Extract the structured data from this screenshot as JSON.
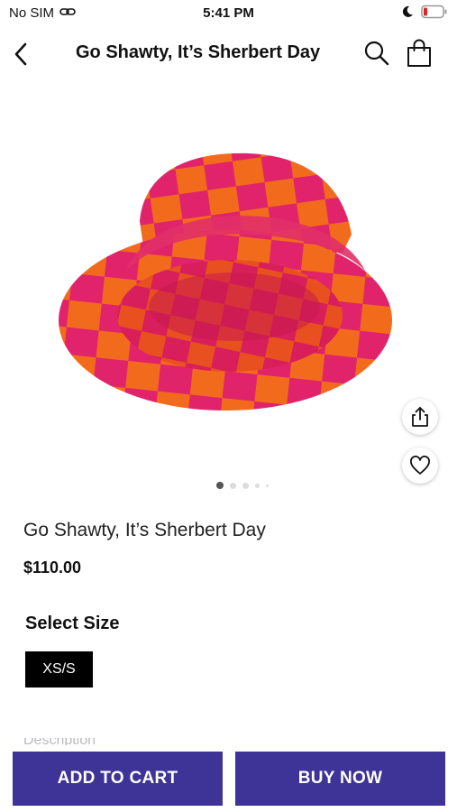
{
  "status": {
    "carrier": "No SIM",
    "time": "5:41 PM"
  },
  "header": {
    "title": "Go Shawty, It’s Sherbert Day",
    "icons": [
      "back-arrow-icon",
      "search-icon",
      "shopping-bag-icon"
    ]
  },
  "gallery": {
    "image_alt": "Crochet checkered bucket hat in orange and pink",
    "page_count": 5,
    "current_page": 1,
    "colors": {
      "orange": "#f06a1a",
      "pink": "#e0236b"
    }
  },
  "product": {
    "name": "Go Shawty, It’s Sherbert Day",
    "price": "$110.00"
  },
  "size": {
    "heading": "Select Size",
    "options": [
      "XS/S"
    ],
    "selected": "XS/S"
  },
  "footer_hint": "Description",
  "actions": {
    "add_to_cart": "ADD TO CART",
    "buy_now": "BUY NOW",
    "button_color": "#3e3396"
  }
}
